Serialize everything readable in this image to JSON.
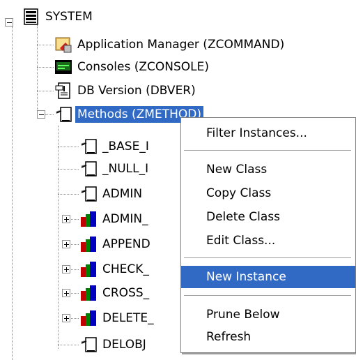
{
  "tree": {
    "root": {
      "label": "SYSTEM",
      "icon": "server-stack-icon"
    },
    "children": [
      {
        "label": "Application Manager (ZCOMMAND)",
        "icon": "app-manager-icon"
      },
      {
        "label": "Consoles (ZCONSOLE)",
        "icon": "console-monitor-icon"
      },
      {
        "label": "DB Version (DBVER)",
        "icon": "db-version-icon"
      },
      {
        "label": "Methods (ZMETHOD)",
        "icon": "method-script-icon",
        "selected": true
      }
    ],
    "methods": [
      {
        "label": "_BASE_I",
        "icon": "method-script-icon",
        "expandable": false
      },
      {
        "label": "_NULL_I",
        "icon": "method-script-icon",
        "expandable": false
      },
      {
        "label": "ADMIN",
        "icon": "method-script-icon",
        "expandable": false
      },
      {
        "label": "ADMIN_",
        "icon": "class-blocks-icon",
        "expandable": true
      },
      {
        "label": "APPEND",
        "icon": "class-blocks-icon",
        "expandable": true
      },
      {
        "label": "CHECK_",
        "icon": "class-blocks-icon",
        "expandable": true
      },
      {
        "label": "CROSS_",
        "icon": "class-blocks-icon",
        "expandable": true
      },
      {
        "label": "DELETE_",
        "icon": "class-blocks-icon",
        "expandable": true
      },
      {
        "label": "DELOBJ",
        "icon": "method-script-icon",
        "expandable": false
      }
    ]
  },
  "context_menu": {
    "items": [
      {
        "label": "Filter Instances..."
      },
      {
        "label": "New Class"
      },
      {
        "label": "Copy Class"
      },
      {
        "label": "Delete Class"
      },
      {
        "label": "Edit Class..."
      },
      {
        "label": "New Instance",
        "highlighted": true
      },
      {
        "label": "Prune Below"
      },
      {
        "label": "Refresh"
      }
    ]
  },
  "colors": {
    "selection": "#316ac5",
    "selection_text": "#ffffff"
  }
}
